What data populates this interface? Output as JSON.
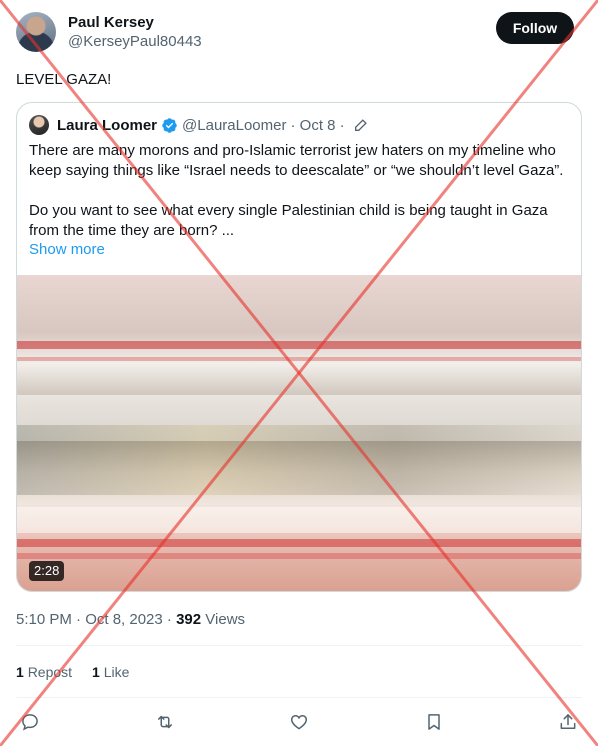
{
  "author": {
    "name": "Paul Kersey",
    "handle": "@KerseyPaul80443",
    "follow_label": "Follow"
  },
  "tweet": {
    "text": "LEVEL GAZA!"
  },
  "quoted": {
    "name": "Laura Loomer",
    "handle": "@LauraLoomer",
    "date": "· Oct 8 ·",
    "paragraph1": "There are many morons and pro-Islamic terrorist jew haters on my timeline who keep saying things like “Israel needs to deescalate” or “we shouldn’t level Gaza”.",
    "paragraph2": "Do you want to see what every single Palestinian child is being taught in Gaza from the time they are born? ...",
    "show_more": "Show more",
    "video_duration": "2:28"
  },
  "meta": {
    "time": "5:10 PM · Oct 8, 2023 ·",
    "views_count": "392",
    "views_label": "Views"
  },
  "stats": {
    "reposts_count": "1",
    "reposts_label": "Repost",
    "likes_count": "1",
    "likes_label": "Like"
  },
  "colors": {
    "accent": "#1d9bf0",
    "cross": "#e8302a"
  }
}
